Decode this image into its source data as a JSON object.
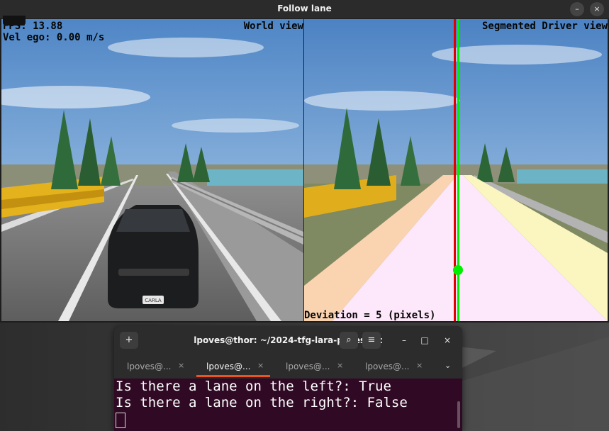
{
  "lane_window": {
    "title": "Follow lane",
    "minimize_label": "–",
    "close_label": "×"
  },
  "world_view": {
    "label": "World view",
    "fps_text": "FPS: 13.88",
    "vel_text": "Vel ego: 0.00 m/s",
    "plate_text": "CARLA"
  },
  "segmented_view": {
    "label": "Segmented Driver view",
    "deviation_text": "Deviation = 5 (pixels)",
    "colors": {
      "left_lane": "#fad3b0",
      "ego_lane": "#fde7fb",
      "right_lane": "#fbf6c0",
      "center_line": "#e00000",
      "lane_center": "#00ee00"
    }
  },
  "terminal": {
    "title": "lpoves@thor: ~/2024-tfg-lara-poves/src",
    "new_tab_icon": "+",
    "search_icon": "⌕",
    "menu_icon": "≡",
    "minimize_label": "–",
    "maximize_label": "□",
    "close_label": "×",
    "tabs": [
      {
        "label": "lpoves@...",
        "close": "×"
      },
      {
        "label": "lpoves@...",
        "close": "×"
      },
      {
        "label": "lpoves@...",
        "close": "×"
      },
      {
        "label": "lpoves@...",
        "close": "×"
      }
    ],
    "overflow_label": "⌄",
    "lines": [
      "Is there a lane on the left?: True",
      "Is there a lane on the right?: False"
    ]
  }
}
